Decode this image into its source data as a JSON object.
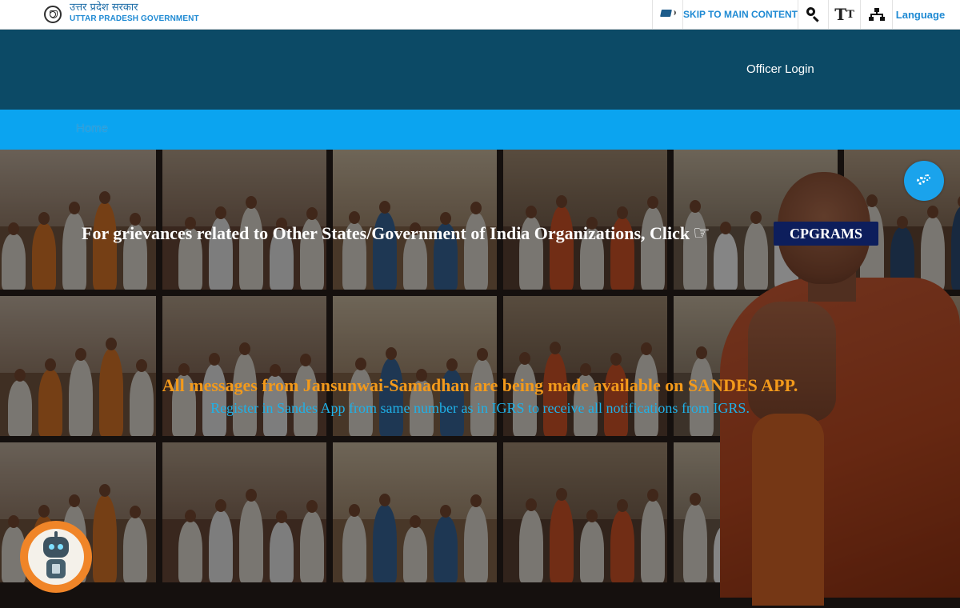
{
  "topbar": {
    "gov_name_hindi": "उत्तर प्रदेश सरकार",
    "gov_name_english": "UTTAR PRADESH GOVERNMENT",
    "skip_label": "SKIP TO MAIN CONTENT",
    "text_size_label_big": "T",
    "text_size_label_small": "T",
    "language_label": "Language",
    "icons": [
      "emblem-icon",
      "screen-reader-icon",
      "search-icon",
      "text-size-icon",
      "sitemap-icon"
    ]
  },
  "header": {
    "officer_login_label": "Officer Login",
    "background_color": "#0c4a66"
  },
  "nav": {
    "items": [
      {
        "label": "Home"
      }
    ],
    "background_color": "#0ba4f0"
  },
  "hero": {
    "grievance_text": "For grievances related to Other States/Government of India Organizations, Click",
    "pointer_icon": "hand-pointing-right-icon",
    "cpgrams_label": "CPGRAMS",
    "sandes_title": "All messages from Jansunwai-Samadhan are being made available on SANDES APP.",
    "sandes_subtitle": "Register in Sandes App from same number as in IGRS to receive all notifications from IGRS.",
    "colors": {
      "sandes_title": "#f39a1b",
      "sandes_subtitle": "#1fb1e8",
      "cpgrams_button": "#0d1e5c"
    }
  },
  "floating": {
    "settings_icon": "gears-icon",
    "chatbot_icon": "robot-icon"
  }
}
